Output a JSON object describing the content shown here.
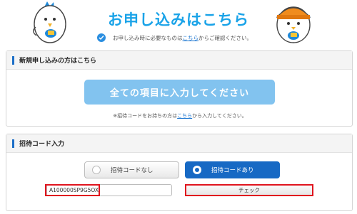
{
  "header": {
    "title": "お申し込みはこちら",
    "notice_before": "お申し込み時に必要なものは",
    "notice_link": "こちら",
    "notice_after": "からご確認ください。"
  },
  "new_section": {
    "heading": "新規申し込みの方はこちら",
    "button_label": "全ての項目に入力してください",
    "note_before": "※招待コードをお持ちの方は",
    "note_link": "こちら",
    "note_after": "から入力してください。"
  },
  "invite_section": {
    "heading": "招待コード入力",
    "option_none": "招待コードなし",
    "option_has": "招待コードあり",
    "selected": "招待コードあり",
    "code_value": "A100000SP9G5OX",
    "check_label": "チェック"
  },
  "colors": {
    "title_blue": "#1aa3e8",
    "selected_blue": "#1769c4",
    "disabled_button": "#82c3ef",
    "highlight_red": "#e0141e"
  },
  "icons": [
    "bird-mascot-icon",
    "chick-mascot-icon",
    "checkmark-icon",
    "radio-icon"
  ]
}
